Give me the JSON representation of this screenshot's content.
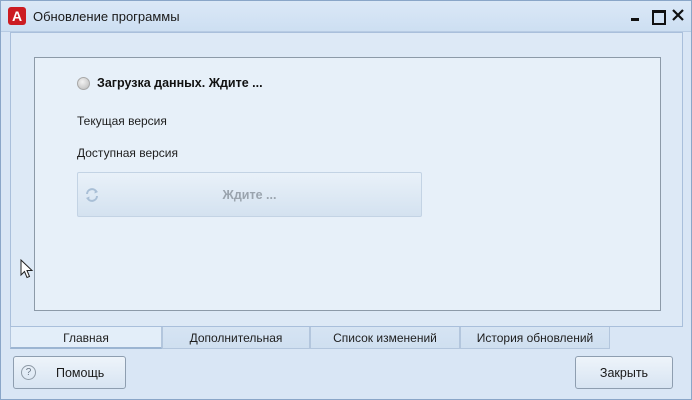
{
  "window": {
    "title": "Обновление программы",
    "app_icon_letter": "A"
  },
  "status": {
    "text": "Загрузка данных. Ждите ..."
  },
  "labels": {
    "current_version": "Текущая версия",
    "available_version": "Доступная версия"
  },
  "update_button": {
    "label": "Ждите ...",
    "icon": "refresh-icon"
  },
  "tabs": [
    {
      "label": "Главная",
      "active": true
    },
    {
      "label": "Дополнительная",
      "active": false
    },
    {
      "label": "Список изменений",
      "active": false
    },
    {
      "label": "История обновлений",
      "active": false
    }
  ],
  "footer": {
    "help_label": "Помощь",
    "help_icon_glyph": "?",
    "close_label": "Закрыть"
  },
  "colors": {
    "accent_red": "#cc1c22",
    "window_bg": "#d9e6f5",
    "panel_bg": "#e7f0f9"
  }
}
